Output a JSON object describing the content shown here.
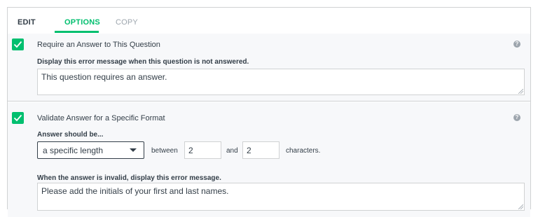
{
  "tabs": [
    {
      "label": "EDIT"
    },
    {
      "label": "OPTIONS",
      "active": true
    },
    {
      "label": "COPY"
    }
  ],
  "required": {
    "checked": true,
    "title": "Require an Answer to This Question",
    "message_label": "Display this error message when this question is not answered.",
    "message_value": "This question requires an answer."
  },
  "validate": {
    "checked": true,
    "title": "Validate Answer for a Specific Format",
    "answer_label": "Answer should be...",
    "format_selected": "a specific length",
    "between_label": "between",
    "min_value": "2",
    "and_label": "and",
    "max_value": "2",
    "unit_label": "characters.",
    "invalid_label": "When the answer is invalid, display this error message.",
    "invalid_value": "Please add the initials of your first and last names."
  },
  "help_icon": "?",
  "colors": {
    "accent": "#00bf6f",
    "text": "#333e48",
    "muted": "#9da5ad",
    "section_bg": "#f7f8fa",
    "border": "#d0d2d3"
  }
}
